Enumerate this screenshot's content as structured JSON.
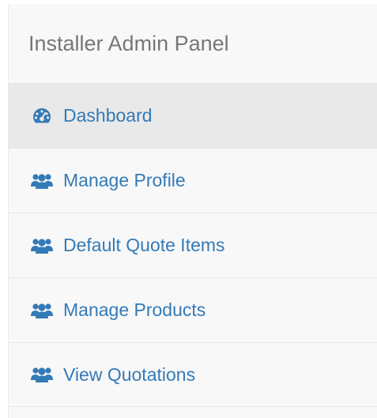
{
  "sidebar": {
    "title": "Installer Admin Panel",
    "items": [
      {
        "label": "Dashboard",
        "icon": "dashboard-icon",
        "active": true
      },
      {
        "label": "Manage Profile",
        "icon": "users-icon",
        "active": false
      },
      {
        "label": "Default Quote Items",
        "icon": "users-icon",
        "active": false
      },
      {
        "label": "Manage Products",
        "icon": "users-icon",
        "active": false
      },
      {
        "label": "View Quotations",
        "icon": "users-icon",
        "active": false
      }
    ]
  },
  "colors": {
    "link": "#337ab7",
    "title": "#777777",
    "panel_bg": "#f8f8f8",
    "active_bg": "#e9e9e9",
    "divider": "#e7e7e7"
  }
}
